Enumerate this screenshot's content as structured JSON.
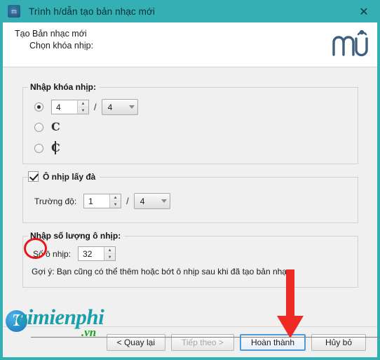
{
  "window": {
    "title": "Trình h/dẫn tạo bản nhạc mới",
    "icon": "musescore-icon",
    "close_label": "✕",
    "titlebar_color": "#34b0b5"
  },
  "header": {
    "line1": "Tạo Bản nhạc mới",
    "line2": "Chọn khóa nhịp:",
    "logo": "musescore-logo"
  },
  "time_signature": {
    "group_title": "Nhập khóa nhịp:",
    "options": [
      {
        "type": "numeric",
        "selected": true,
        "numerator": "4",
        "denominator": "4"
      },
      {
        "type": "common_time",
        "selected": false,
        "symbol": "𝄴"
      },
      {
        "type": "cut_time",
        "selected": false,
        "symbol": "𝄵"
      }
    ]
  },
  "pickup": {
    "checkbox_label": "Ô nhịp lấy đà",
    "checked": true,
    "duration_label": "Trường độ:",
    "duration_numerator": "1",
    "duration_denominator": "4"
  },
  "measures": {
    "group_title": "Nhập số lượng ô nhịp:",
    "count_label": "Số ô nhịp:",
    "count_value": "32",
    "hint": "Gợi ý: Bạn cũng có thể thêm hoặc bớt ô nhịp sau khi đã tạo bản nhạc."
  },
  "footer": {
    "back": "< Quay lại",
    "next": "Tiếp theo >",
    "finish": "Hoàn thành",
    "cancel": "Hủy bỏ"
  },
  "annotations": {
    "circle_color": "#e8151d",
    "arrow_color": "#ee2a24"
  },
  "watermark": {
    "badge": "T",
    "text": "aimienphi",
    "tld": ".vn"
  }
}
